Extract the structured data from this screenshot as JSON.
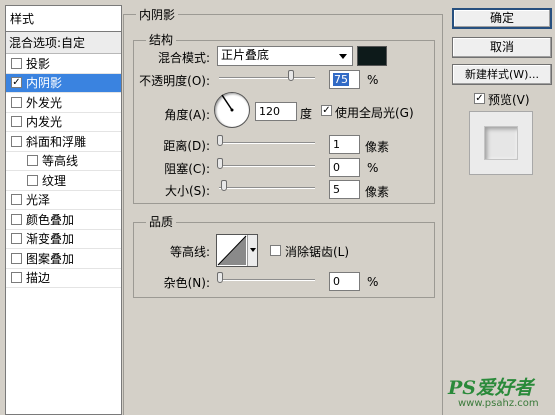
{
  "style_panel": {
    "header": "样式",
    "blending_options": "混合选项:自定",
    "items": [
      {
        "label": "投影",
        "checked": false,
        "selected": false,
        "sub": false
      },
      {
        "label": "内阴影",
        "checked": true,
        "selected": true,
        "sub": false
      },
      {
        "label": "外发光",
        "checked": false,
        "selected": false,
        "sub": false
      },
      {
        "label": "内发光",
        "checked": false,
        "selected": false,
        "sub": false
      },
      {
        "label": "斜面和浮雕",
        "checked": false,
        "selected": false,
        "sub": false
      },
      {
        "label": "等高线",
        "checked": false,
        "selected": false,
        "sub": true
      },
      {
        "label": "纹理",
        "checked": false,
        "selected": false,
        "sub": true
      },
      {
        "label": "光泽",
        "checked": false,
        "selected": false,
        "sub": false
      },
      {
        "label": "颜色叠加",
        "checked": false,
        "selected": false,
        "sub": false
      },
      {
        "label": "渐变叠加",
        "checked": false,
        "selected": false,
        "sub": false
      },
      {
        "label": "图案叠加",
        "checked": false,
        "selected": false,
        "sub": false
      },
      {
        "label": "描边",
        "checked": false,
        "selected": false,
        "sub": false
      }
    ]
  },
  "inner_shadow": {
    "title": "内阴影",
    "structure_title": "结构",
    "blend_mode_label": "混合模式:",
    "blend_mode_value": "正片叠底",
    "shadow_color": "#0d1a1a",
    "opacity_label": "不透明度(O):",
    "opacity_value": "75",
    "opacity_fraction": 0.75,
    "percent": "%",
    "angle_label": "角度(A):",
    "angle_value": "120",
    "angle_unit": "度",
    "global_light_label": "使用全局光(G)",
    "global_light_checked": true,
    "distance_label": "距离(D):",
    "distance_value": "1",
    "choke_label": "阻塞(C):",
    "choke_value": "0",
    "size_label": "大小(S):",
    "size_value": "5",
    "pixels": "像素"
  },
  "quality": {
    "title": "品质",
    "contour_label": "等高线:",
    "anti_alias_label": "消除锯齿(L)",
    "anti_alias_checked": false,
    "noise_label": "杂色(N):",
    "noise_value": "0",
    "percent": "%"
  },
  "buttons": {
    "ok": "确定",
    "cancel": "取消",
    "new_style": "新建样式(W)...",
    "preview_label": "预览(V)",
    "preview_checked": true
  },
  "watermark": {
    "logo": "PS爱好者",
    "url": "www.psahz.com"
  }
}
